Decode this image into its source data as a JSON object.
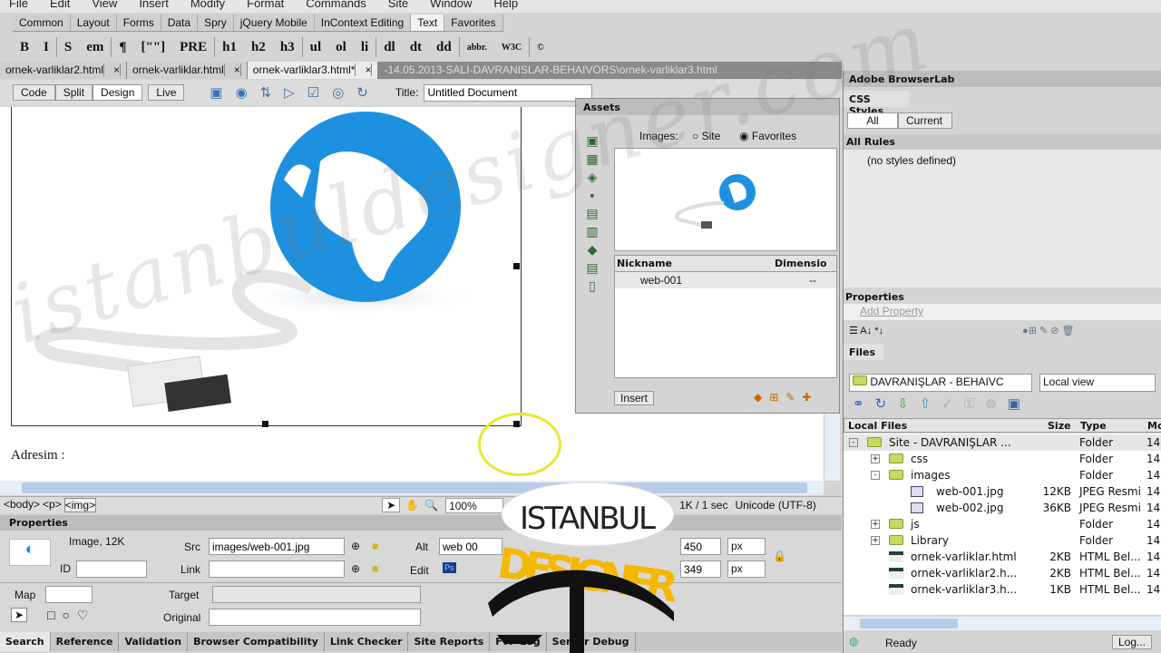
{
  "menu": [
    "File",
    "Edit",
    "View",
    "Insert",
    "Modify",
    "Format",
    "Commands",
    "Site",
    "Window",
    "Help"
  ],
  "insert_tabs": [
    "Common",
    "Layout",
    "Forms",
    "Data",
    "Spry",
    "jQuery Mobile",
    "InContext Editing",
    "Text",
    "Favorites"
  ],
  "insert_active": "Text",
  "text_toolbar": [
    "B",
    "I",
    "S",
    "em",
    "¶",
    "[\"\"]",
    "PRE",
    "h1",
    "h2",
    "h3",
    "ul",
    "ol",
    "li",
    "dl",
    "dt",
    "dd",
    "abbr.",
    "W3C",
    "©"
  ],
  "doc_tabs": [
    "ornek-varliklar2.html",
    "ornek-varliklar.html",
    "ornek-varliklar3.html*"
  ],
  "doc_path": "-14.05.2013-SALI-DAVRANISLAR-BEHAIVORS\\ornek-varliklar3.html",
  "view_buttons": [
    "Code",
    "Split",
    "Design",
    "Live"
  ],
  "title_label": "Title:",
  "title_value": "Untitled Document",
  "design_text": "Adresim :",
  "status": {
    "tags": [
      "<body>",
      "<p>",
      "<img>"
    ],
    "zoom": "100%",
    "size": "1K / 1 sec",
    "encoding": "Unicode (UTF-8)"
  },
  "properties": {
    "header": "Properties",
    "type": "Image, 12K",
    "id_label": "ID",
    "src_label": "Src",
    "src_value": "images/web-001.jpg",
    "link_label": "Link",
    "alt_label": "Alt",
    "alt_value": "web 00",
    "edit_label": "Edit",
    "w": "450",
    "h": "349",
    "unit": "px",
    "map_label": "Map",
    "target_label": "Target",
    "original_label": "Original"
  },
  "bottom_tabs": [
    "Search",
    "Reference",
    "Validation",
    "Browser Compatibility",
    "Link Checker",
    "Site Reports",
    "FTP Log",
    "Server Debug"
  ],
  "assets": {
    "title": "Assets",
    "images_label": "Images:",
    "site": "Site",
    "favorites": "Favorites",
    "col_nickname": "Nickname",
    "col_dimension": "Dimensio",
    "rows": [
      {
        "name": "web-001",
        "dim": "--"
      }
    ],
    "insert": "Insert"
  },
  "right": {
    "browserlab": "Adobe BrowserLab",
    "css_tab": "CSS Styles",
    "all": "All",
    "current": "Current",
    "all_rules": "All Rules",
    "no_styles": "(no styles defined)",
    "properties": "Properties",
    "add_property": "Add Property",
    "files_tab": "Files",
    "site_select": "DAVRANIŞLAR - BEHAIVC",
    "view_select": "Local view",
    "cols": [
      "Local Files",
      "Size",
      "Type",
      "Mo"
    ],
    "files": [
      {
        "name": "Site - DAVRANIŞLAR ...",
        "size": "",
        "type": "Folder",
        "mod": "14",
        "lvl": 0,
        "kind": "folder",
        "exp": "-"
      },
      {
        "name": "css",
        "size": "",
        "type": "Folder",
        "mod": "14",
        "lvl": 1,
        "kind": "folder",
        "exp": "+"
      },
      {
        "name": "images",
        "size": "",
        "type": "Folder",
        "mod": "14",
        "lvl": 1,
        "kind": "folder",
        "exp": "-"
      },
      {
        "name": "web-001.jpg",
        "size": "12KB",
        "type": "JPEG Resmi",
        "mod": "14",
        "lvl": 2,
        "kind": "image",
        "exp": ""
      },
      {
        "name": "web-002.jpg",
        "size": "36KB",
        "type": "JPEG Resmi",
        "mod": "14",
        "lvl": 2,
        "kind": "image",
        "exp": ""
      },
      {
        "name": "js",
        "size": "",
        "type": "Folder",
        "mod": "14",
        "lvl": 1,
        "kind": "folder",
        "exp": "+"
      },
      {
        "name": "Library",
        "size": "",
        "type": "Folder",
        "mod": "14",
        "lvl": 1,
        "kind": "folder",
        "exp": "+"
      },
      {
        "name": "ornek-varliklar.html",
        "size": "2KB",
        "type": "HTML Bel...",
        "mod": "14",
        "lvl": 1,
        "kind": "html",
        "exp": ""
      },
      {
        "name": "ornek-varliklar2.h...",
        "size": "2KB",
        "type": "HTML Bel...",
        "mod": "14",
        "lvl": 1,
        "kind": "html",
        "exp": ""
      },
      {
        "name": "ornek-varliklar3.h...",
        "size": "1KB",
        "type": "HTML Bel...",
        "mod": "14",
        "lvl": 1,
        "kind": "html",
        "exp": ""
      }
    ],
    "ready": "Ready",
    "log": "Log..."
  },
  "logo": {
    "line1": "ISTANBUL",
    "line2": "DESIGNER"
  },
  "watermark": "istanbuldesigner.com",
  "colors": {
    "globe": "#1e90e0",
    "logo_yellow": "#f5b800",
    "selection_yellow": "#e8e830"
  }
}
